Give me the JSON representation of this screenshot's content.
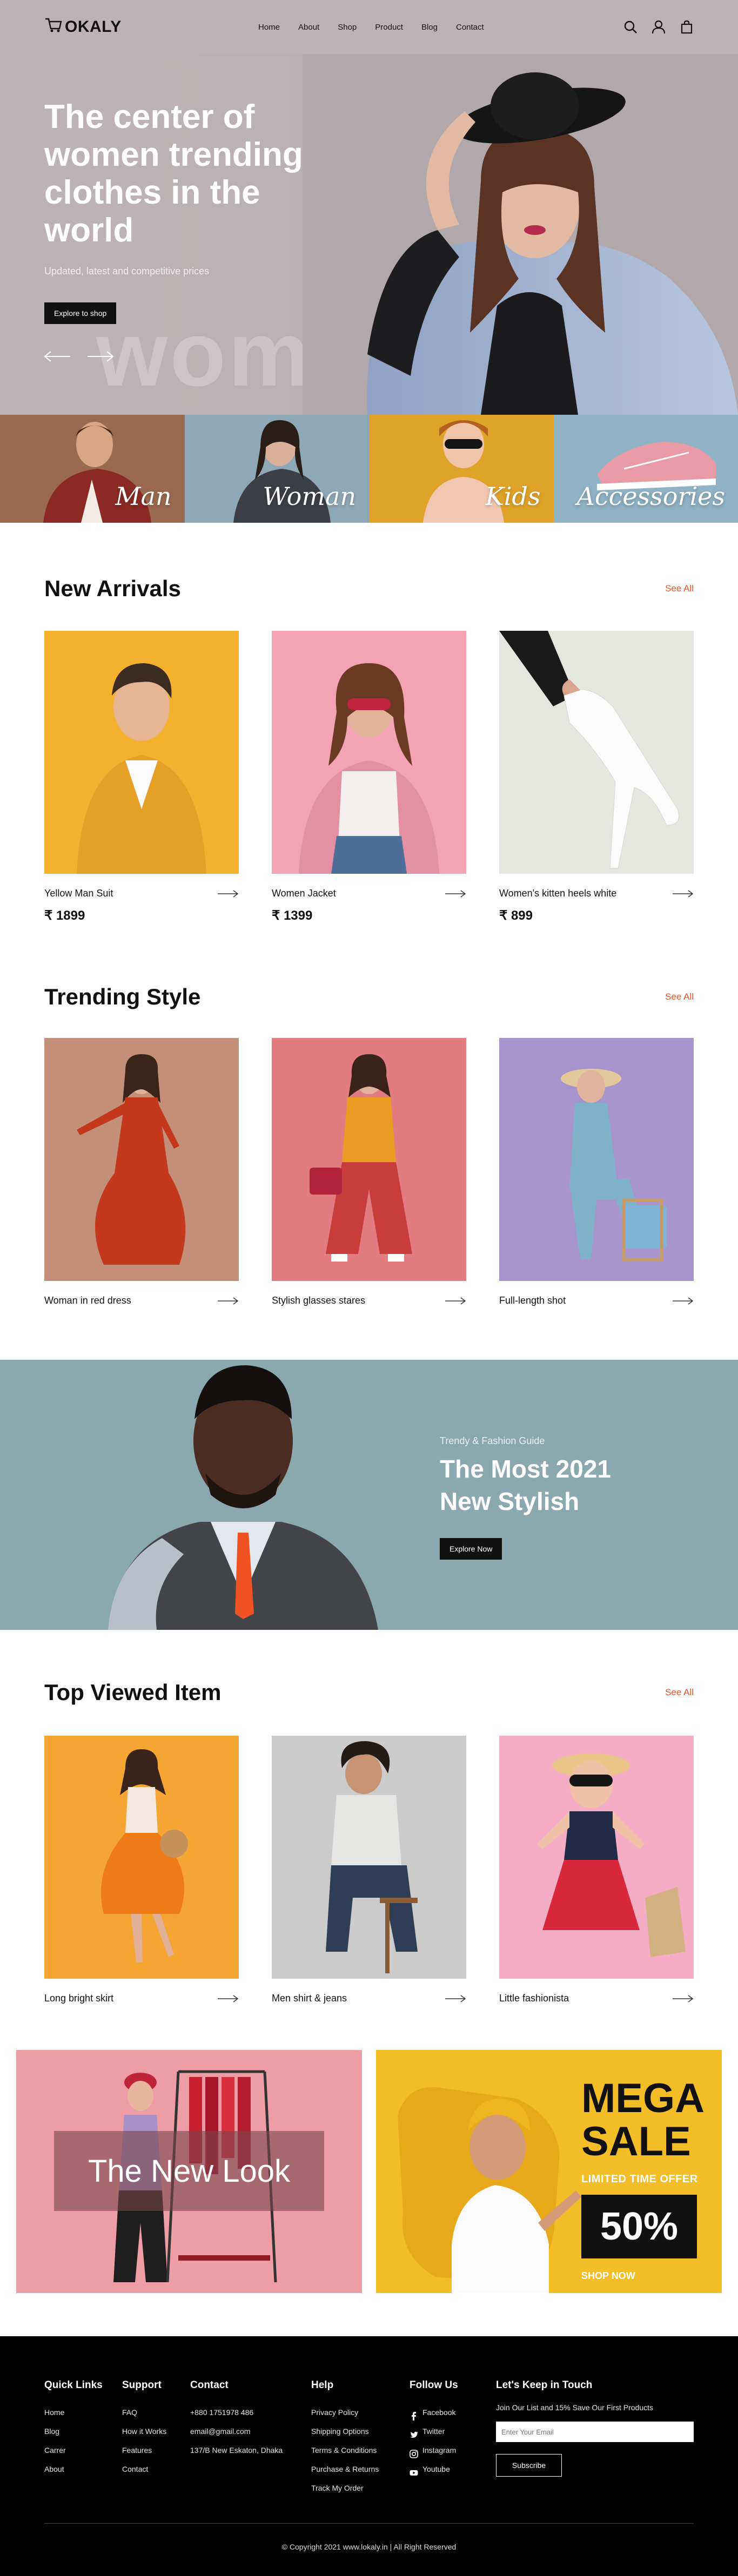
{
  "brand": {
    "logo_text": "OKALY"
  },
  "nav": {
    "links": [
      "Home",
      "About",
      "Shop",
      "Product",
      "Blog",
      "Contact"
    ],
    "icons": [
      "search-icon",
      "user-icon",
      "bag-icon"
    ]
  },
  "hero": {
    "title": "The center of women trending clothes in the world",
    "subtitle": "Updated, latest and competitive prices",
    "cta": "Explore to shop",
    "bg_word": "women"
  },
  "categories": [
    "Man",
    "Woman",
    "Kids",
    "Accessories"
  ],
  "new_arrivals": {
    "title": "New Arrivals",
    "see_all": "See All",
    "items": [
      {
        "name": "Yellow Man Suit",
        "price": "₹ 1899"
      },
      {
        "name": "Women Jacket",
        "price": "₹ 1399"
      },
      {
        "name": "Women's kitten heels white",
        "price": "₹ 899"
      }
    ]
  },
  "trending": {
    "title": "Trending Style",
    "see_all": "See All",
    "items": [
      {
        "name": "Woman in red dress"
      },
      {
        "name": "Stylish glasses stares"
      },
      {
        "name": "Full-length shot"
      }
    ]
  },
  "banner": {
    "kicker": "Trendy & Fashion Guide",
    "title": "The Most 2021 New Stylish",
    "cta": "Explore Now"
  },
  "top_viewed": {
    "title": "Top Viewed Item",
    "see_all": "See All",
    "items": [
      {
        "name": "Long bright skirt"
      },
      {
        "name": "Men shirt & jeans"
      },
      {
        "name": "Little fashionista"
      }
    ]
  },
  "offers": {
    "new_look": "The New Look",
    "mega": "MEGA",
    "sale": "SALE",
    "limited": "LIMITED TIME OFFER",
    "percent": "50%",
    "shop_now": "SHOP NOW"
  },
  "footer": {
    "quick_links": {
      "title": "Quick Links",
      "items": [
        "Home",
        "Blog",
        "Carrer",
        "About"
      ]
    },
    "support": {
      "title": "Support",
      "items": [
        "FAQ",
        "How it Works",
        "Features",
        "Contact"
      ]
    },
    "contact": {
      "title": "Contact",
      "items": [
        "+880 1751978 486",
        "email@gmail.com",
        "137/B New Eskaton, Dhaka"
      ]
    },
    "help": {
      "title": "Help",
      "items": [
        "Privacy Policy",
        "Shipping Options",
        "Terms & Conditions",
        "Purchase & Returns",
        "Track My Order"
      ]
    },
    "follow": {
      "title": "Follow Us",
      "items": [
        "Facebook",
        "Twitter",
        "Instagram",
        "Youtube"
      ]
    },
    "keep": {
      "title": "Let's Keep in Touch",
      "subtitle": "Join Our List and 15% Save Our First Products",
      "email_placeholder": "Enter Your Email",
      "subscribe": "Subscribe"
    },
    "copyright": "© Copyright 2021 www.lokaly.in | All Right Reserved"
  },
  "colors": {
    "accent": "#e0572a",
    "hero_bg": "#bdb3b6",
    "footer_bg": "#000000"
  }
}
